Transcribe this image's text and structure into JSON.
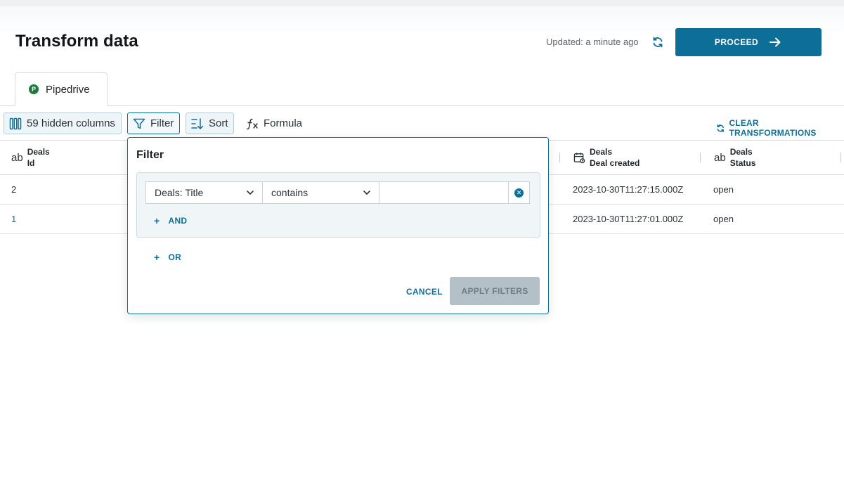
{
  "header": {
    "title": "Transform data",
    "updated": "Updated: a minute ago",
    "proceed_label": "PROCEED"
  },
  "tabs": [
    {
      "label": "Pipedrive",
      "icon": "pipedrive-icon",
      "icon_glyph": "P",
      "active": true
    }
  ],
  "toolbar": {
    "hidden_columns": "59 hidden columns",
    "filter": "Filter",
    "sort": "Sort",
    "formula": "Formula",
    "clear_transformations": "CLEAR TRANSFORMATIONS"
  },
  "table": {
    "columns": [
      {
        "type": "ab",
        "line1": "Deals",
        "line2": "Id"
      },
      {
        "type": "calendar-icon",
        "line1": "Deals",
        "line2": "Deal created"
      },
      {
        "type": "ab",
        "line1": "Deals",
        "line2": "Status"
      }
    ],
    "rows": [
      {
        "id": "2",
        "deal_created": "2023-10-30T11:27:15.000Z",
        "status": "open"
      },
      {
        "id": "1",
        "deal_created": "2023-10-30T11:27:01.000Z",
        "status": "open"
      }
    ]
  },
  "filter_popover": {
    "title": "Filter",
    "field_select": "Deals: Title",
    "operator_select": "contains",
    "value": "",
    "and_label": "AND",
    "or_label": "OR",
    "cancel_label": "CANCEL",
    "apply_label": "APPLY FILTERS"
  },
  "colors": {
    "accent": "#0d6f98",
    "pipedrive_green": "#1b7a3c",
    "disabled_button": "#b4c0c7"
  }
}
